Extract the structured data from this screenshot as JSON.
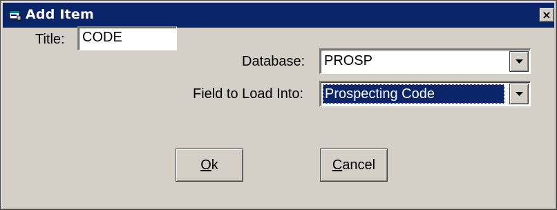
{
  "window": {
    "title": "Add Item",
    "close_glyph": "×",
    "icon": "app-window-icon"
  },
  "form": {
    "title_label": "Title:",
    "title_value": "CODE",
    "database_label": "Database:",
    "database_value": "PROSP",
    "field_label": "Field to Load Into:",
    "field_value": "Prospecting Code"
  },
  "buttons": {
    "ok_mnemonic": "O",
    "ok_rest": "k",
    "cancel_mnemonic": "C",
    "cancel_rest": "ancel"
  },
  "colors": {
    "titlebar": "#0a246a",
    "face": "#d4d0c8",
    "selection": "#0a246a"
  }
}
